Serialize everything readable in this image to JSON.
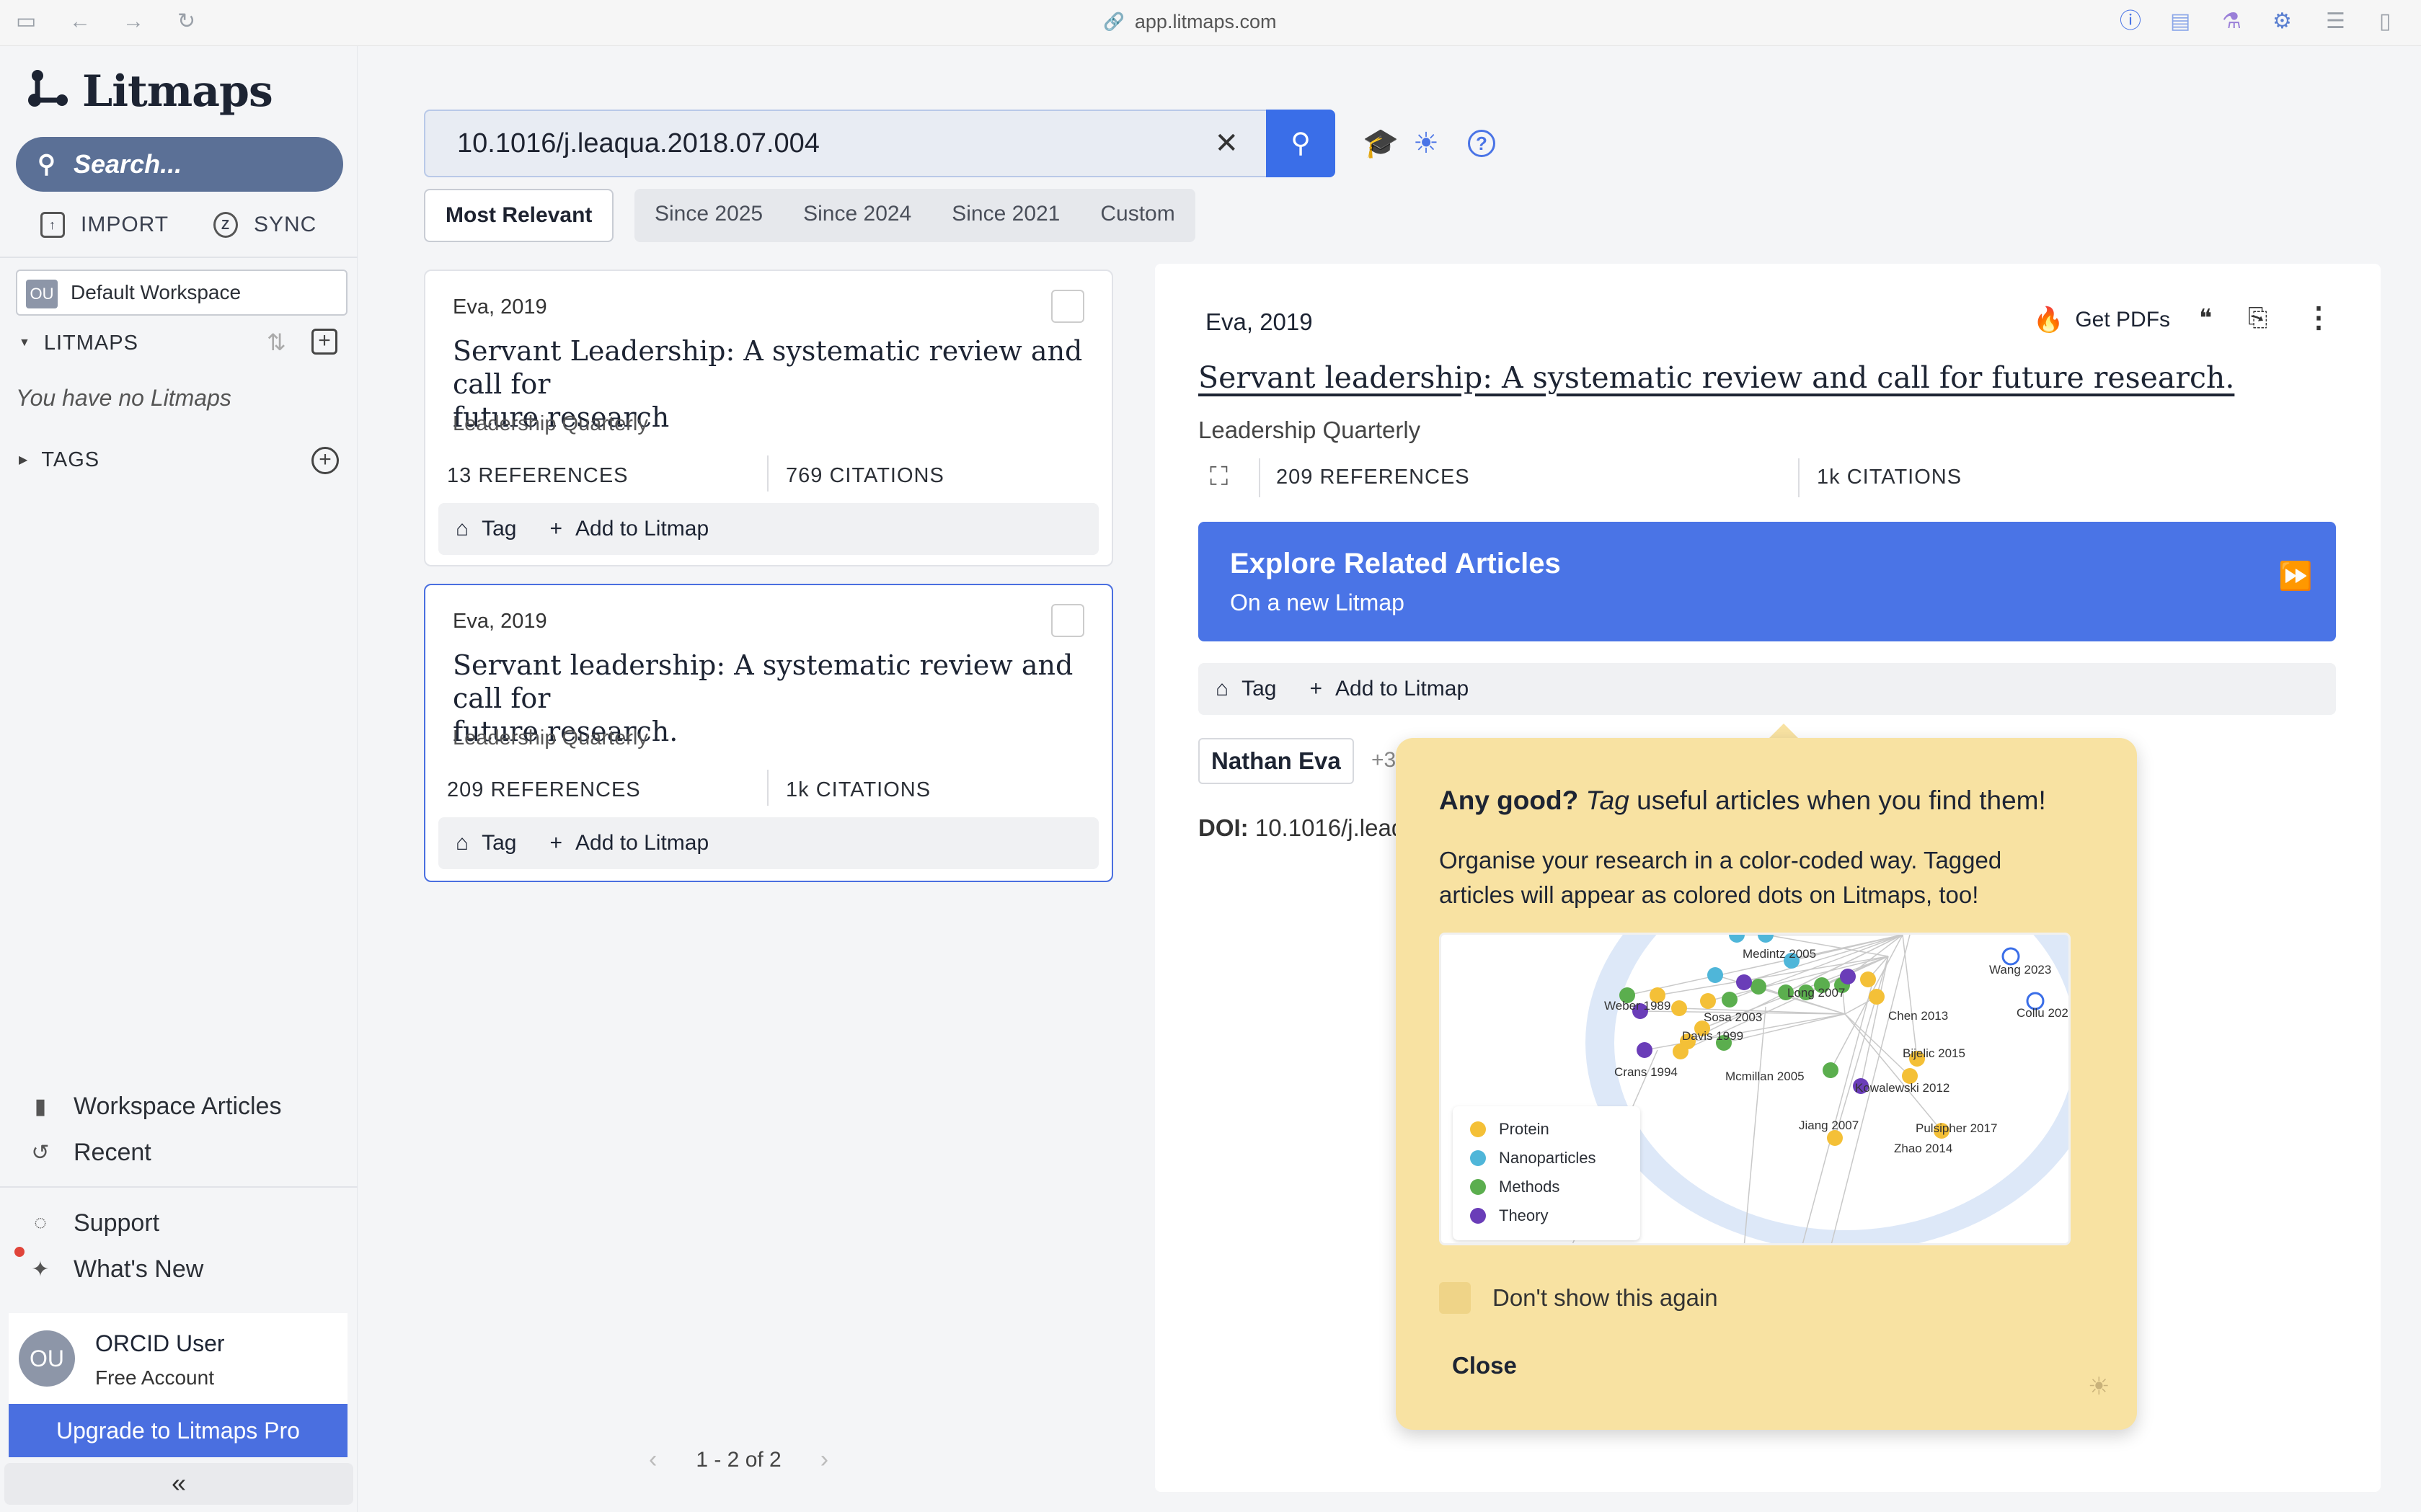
{
  "browser": {
    "url": "app.litmaps.com"
  },
  "sidebar": {
    "logo": "Litmaps",
    "search_placeholder": "Search...",
    "import_label": "IMPORT",
    "sync_label": "SYNC",
    "workspace_badge": "OU",
    "workspace_name": "Default Workspace",
    "litmaps_section": "LITMAPS",
    "no_litmaps": "You have no Litmaps",
    "tags_section": "TAGS",
    "workspace_articles": "Workspace Articles",
    "recent": "Recent",
    "support": "Support",
    "whats_new": "What's New",
    "user_initials": "OU",
    "user_name": "ORCID User",
    "user_plan": "Free Account",
    "upgrade": "Upgrade to Litmaps Pro",
    "collapse_glyph": "«"
  },
  "search": {
    "query": "10.1016/j.leaqua.2018.07.004"
  },
  "filters": {
    "selected": "Most Relevant",
    "options": [
      "Since 2025",
      "Since 2024",
      "Since 2021",
      "Custom"
    ]
  },
  "results": [
    {
      "meta": "Eva, 2019",
      "title_line1": "Servant Leadership: A systematic review and call for",
      "title_line2": "future research",
      "journal": "Leadership Quarterly",
      "refs": "13",
      "refs_label": "REFERENCES",
      "cites": "769",
      "cites_label": "CITATIONS",
      "tag": "Tag",
      "add": "Add to Litmap"
    },
    {
      "meta": "Eva, 2019",
      "title_line1": "Servant leadership: A systematic review and call for",
      "title_line2": "future research.",
      "journal": "Leadership Quarterly",
      "refs": "209",
      "refs_label": "REFERENCES",
      "cites": "1k",
      "cites_label": "CITATIONS",
      "tag": "Tag",
      "add": "Add to Litmap"
    }
  ],
  "pager": {
    "text": "1 - 2 of 2"
  },
  "detail": {
    "meta": "Eva, 2019",
    "get_pdfs": "Get PDFs",
    "title": "Servant leadership: A systematic review and call for future research.",
    "journal": "Leadership Quarterly",
    "refs": "209",
    "refs_label": "REFERENCES",
    "cites": "1k",
    "cites_label": "CITATIONS",
    "explore_title": "Explore Related Articles",
    "explore_sub": "On a new Litmap",
    "tag": "Tag",
    "add": "Add to Litmap",
    "author": "Nathan Eva",
    "more_authors": "+3",
    "doi_label": "DOI:",
    "doi_value": "10.1016/j.leaq"
  },
  "tip": {
    "heading_bold": "Any good?",
    "heading_italic": "Tag",
    "heading_rest": "useful articles when you find them!",
    "body_line1": "Organise your research in a color-coded way. Tagged",
    "body_line2": "articles will appear as colored dots on Litmaps, too!",
    "dont_show": "Don't show this again",
    "close": "Close",
    "legend": [
      {
        "label": "Protein",
        "color": "#f4c037"
      },
      {
        "label": "Nanoparticles",
        "color": "#4fb6d9"
      },
      {
        "label": "Methods",
        "color": "#5bae4e"
      },
      {
        "label": "Theory",
        "color": "#6a3db8"
      }
    ],
    "map_labels": [
      "Medintz 2005",
      "Wang 2023",
      "Weber 1989",
      "Sosa 2003",
      "Long 2007",
      "Chen 2013",
      "Collu 202",
      "Davis 1999",
      "Crans 1994",
      "Mcmillan 2005",
      "Bijelic 2015",
      "Kowalewski 2012",
      "Jiang 2007",
      "Pulsipher 2017",
      "Zhao 2014"
    ]
  },
  "colors": {
    "accent": "#3a6ee8",
    "tip_bg": "#f8e2a2",
    "sidebar_search": "#5b7096"
  }
}
